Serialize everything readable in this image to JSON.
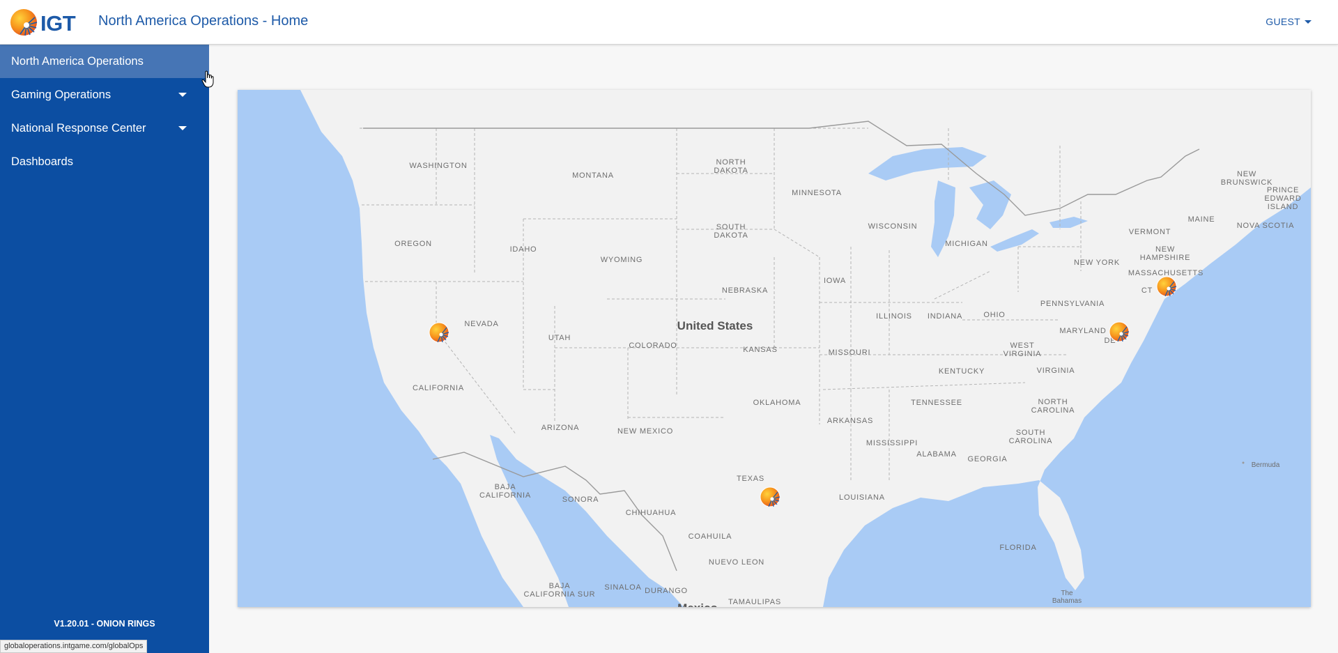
{
  "header": {
    "logo_text": "IGT",
    "title": "North America Operations - Home",
    "user_label": "GUEST"
  },
  "sidebar": {
    "items": [
      {
        "label": "North America Operations",
        "has_submenu": false,
        "active": true
      },
      {
        "label": "Gaming Operations",
        "has_submenu": true,
        "active": false
      },
      {
        "label": "National Response Center",
        "has_submenu": true,
        "active": false
      },
      {
        "label": "Dashboards",
        "has_submenu": false,
        "active": false
      }
    ],
    "version": "V1.20.01 - ONION RINGS"
  },
  "status_bar": {
    "url": "globaloperations.intgame.com/globalOps"
  },
  "map": {
    "country_label": "United States",
    "states": {
      "washington": "WASHINGTON",
      "oregon": "OREGON",
      "idaho": "IDAHO",
      "montana": "MONTANA",
      "north_dakota_1": "NORTH",
      "north_dakota_2": "DAKOTA",
      "south_dakota_1": "SOUTH",
      "south_dakota_2": "DAKOTA",
      "minnesota": "MINNESOTA",
      "wisconsin": "WISCONSIN",
      "michigan": "MICHIGAN",
      "wyoming": "WYOMING",
      "nebraska": "NEBRASKA",
      "iowa": "IOWA",
      "illinois": "ILLINOIS",
      "indiana": "INDIANA",
      "ohio": "OHIO",
      "nevada": "NEVADA",
      "utah": "UTAH",
      "colorado": "COLORADO",
      "kansas": "KANSAS",
      "missouri": "MISSOURI",
      "california": "CALIFORNIA",
      "arizona": "ARIZONA",
      "new_mexico": "NEW MEXICO",
      "oklahoma": "OKLAHOMA",
      "arkansas": "ARKANSAS",
      "texas": "TEXAS",
      "louisiana": "LOUISIANA",
      "mississippi": "MISSISSIPPI",
      "alabama": "ALABAMA",
      "georgia": "GEORGIA",
      "tennessee": "TENNESSEE",
      "kentucky": "KENTUCKY",
      "west_virginia_1": "WEST",
      "west_virginia_2": "VIRGINIA",
      "virginia": "VIRGINIA",
      "north_carolina_1": "NORTH",
      "north_carolina_2": "CAROLINA",
      "south_carolina_1": "SOUTH",
      "south_carolina_2": "CAROLINA",
      "florida": "FLORIDA",
      "pennsylvania": "PENNSYLVANIA",
      "new_york": "NEW YORK",
      "maryland": "MARYLAND",
      "de": "DE",
      "vermont": "VERMONT",
      "new_hampshire_1": "NEW",
      "new_hampshire_2": "HAMPSHIRE",
      "massachusetts": "MASSACHUSETTS",
      "ct": "CT",
      "maine": "MAINE"
    },
    "foreign": {
      "new_brunswick_1": "NEW",
      "new_brunswick_2": "BRUNSWICK",
      "pei_1": "PRINCE",
      "pei_2": "EDWARD",
      "pei_3": "ISLAND",
      "nova_scotia": "NOVA SCOTIA",
      "bermuda": "Bermuda",
      "bahamas_1": "The",
      "bahamas_2": "Bahamas",
      "baja_california_1": "BAJA",
      "baja_california_2": "CALIFORNIA",
      "sonora": "SONORA",
      "chihuahua": "CHIHUAHUA",
      "coahuila": "COAHUILA",
      "nuevo_leon": "NUEVO LEON",
      "baja_california_sur_1": "BAJA",
      "baja_california_sur_2": "CALIFORNIA SUR",
      "sinaloa": "SINALOA",
      "durango": "DURANGO",
      "tamaulipas": "TAMAULIPAS",
      "mexico": "Mexico"
    },
    "colors": {
      "water": "#a9cbf5",
      "land": "#f2f2f2",
      "border": "#b4b4b4",
      "brand_blue": "#1d5aa8",
      "sidebar_blue": "#0c4ea2"
    },
    "markers": [
      {
        "name": "marker-nevada"
      },
      {
        "name": "marker-texas"
      },
      {
        "name": "marker-new-jersey"
      },
      {
        "name": "marker-rhode-island"
      }
    ]
  }
}
